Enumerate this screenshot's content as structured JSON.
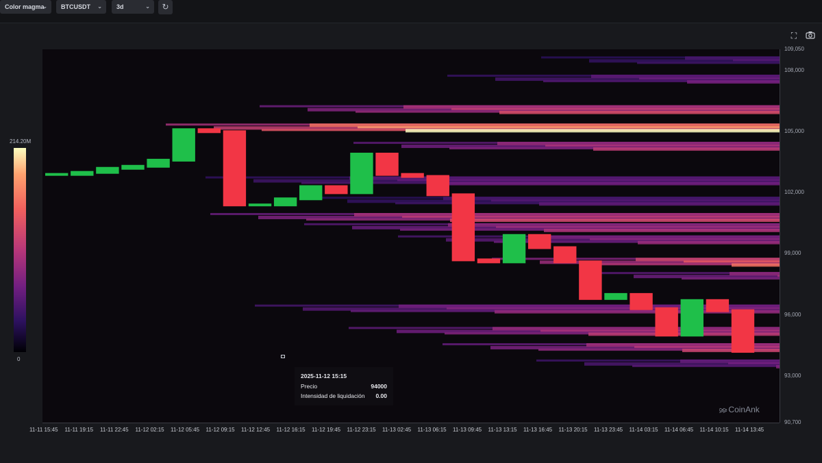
{
  "toolbar": {
    "color_scheme": "Color magma",
    "symbol": "BTCUSDT",
    "timeframe": "3d",
    "refresh_icon": "refresh-icon"
  },
  "panel_icons": {
    "fullscreen": "fullscreen-icon",
    "screenshot": "camera-icon"
  },
  "colorbar": {
    "max_label": "214.20M",
    "min_label": "0",
    "colormap": "magma"
  },
  "tooltip": {
    "title": "2025-11-12 15:15",
    "price_label": "Precio",
    "price_value": "94000",
    "intensity_label": "Intensidad de liquidación",
    "intensity_value": "0.00"
  },
  "watermark": "CoinAnk",
  "colors": {
    "up": "#1fbf4a",
    "down": "#f23645",
    "background": "#131417"
  },
  "chart_data": {
    "type": "heatmap",
    "title": "",
    "xlabel": "",
    "ylabel": "",
    "y_ticks": [
      "109,050",
      "108,000",
      "105,000",
      "102,000",
      "99,000",
      "96,000",
      "93,000",
      "90,700"
    ],
    "y_tick_values": [
      109050,
      108000,
      105000,
      102000,
      99000,
      96000,
      93000,
      90700
    ],
    "ylim": [
      90700,
      109050
    ],
    "x_ticks": [
      "11-11 15:45",
      "11-11 19:15",
      "11-11 22:45",
      "11-12 02:15",
      "11-12 05:45",
      "11-12 09:15",
      "11-12 12:45",
      "11-12 16:15",
      "11-12 19:45",
      "11-12 23:15",
      "11-13 02:45",
      "11-13 06:15",
      "11-13 09:45",
      "11-13 13:15",
      "11-13 16:45",
      "11-13 20:15",
      "11-13 23:45",
      "11-14 03:15",
      "11-14 06:45",
      "11-14 10:15",
      "11-14 13:45"
    ],
    "price_series": {
      "name": "",
      "step_hours": 3.5,
      "close": [
        102900,
        103000,
        103200,
        103300,
        103600,
        105100,
        105000,
        101400,
        101400,
        101700,
        102300,
        102000,
        103900,
        102900,
        102800,
        101900,
        98700,
        98600,
        99900,
        99300,
        98600,
        96800,
        97000,
        96300,
        95000,
        96700,
        96200,
        94200
      ]
    },
    "liquidation_bands": [
      {
        "price": 105200,
        "intensity": 1.0
      },
      {
        "price": 106100,
        "intensity": 0.7
      },
      {
        "price": 104300,
        "intensity": 0.62
      },
      {
        "price": 107600,
        "intensity": 0.42
      },
      {
        "price": 108500,
        "intensity": 0.35
      },
      {
        "price": 100800,
        "intensity": 0.68
      },
      {
        "price": 100300,
        "intensity": 0.58
      },
      {
        "price": 99700,
        "intensity": 0.52
      },
      {
        "price": 98600,
        "intensity": 0.82
      },
      {
        "price": 97900,
        "intensity": 0.6
      },
      {
        "price": 96300,
        "intensity": 0.5
      },
      {
        "price": 95200,
        "intensity": 0.62
      },
      {
        "price": 94400,
        "intensity": 0.66
      },
      {
        "price": 93600,
        "intensity": 0.45
      },
      {
        "price": 102600,
        "intensity": 0.4
      },
      {
        "price": 101600,
        "intensity": 0.35
      }
    ]
  }
}
